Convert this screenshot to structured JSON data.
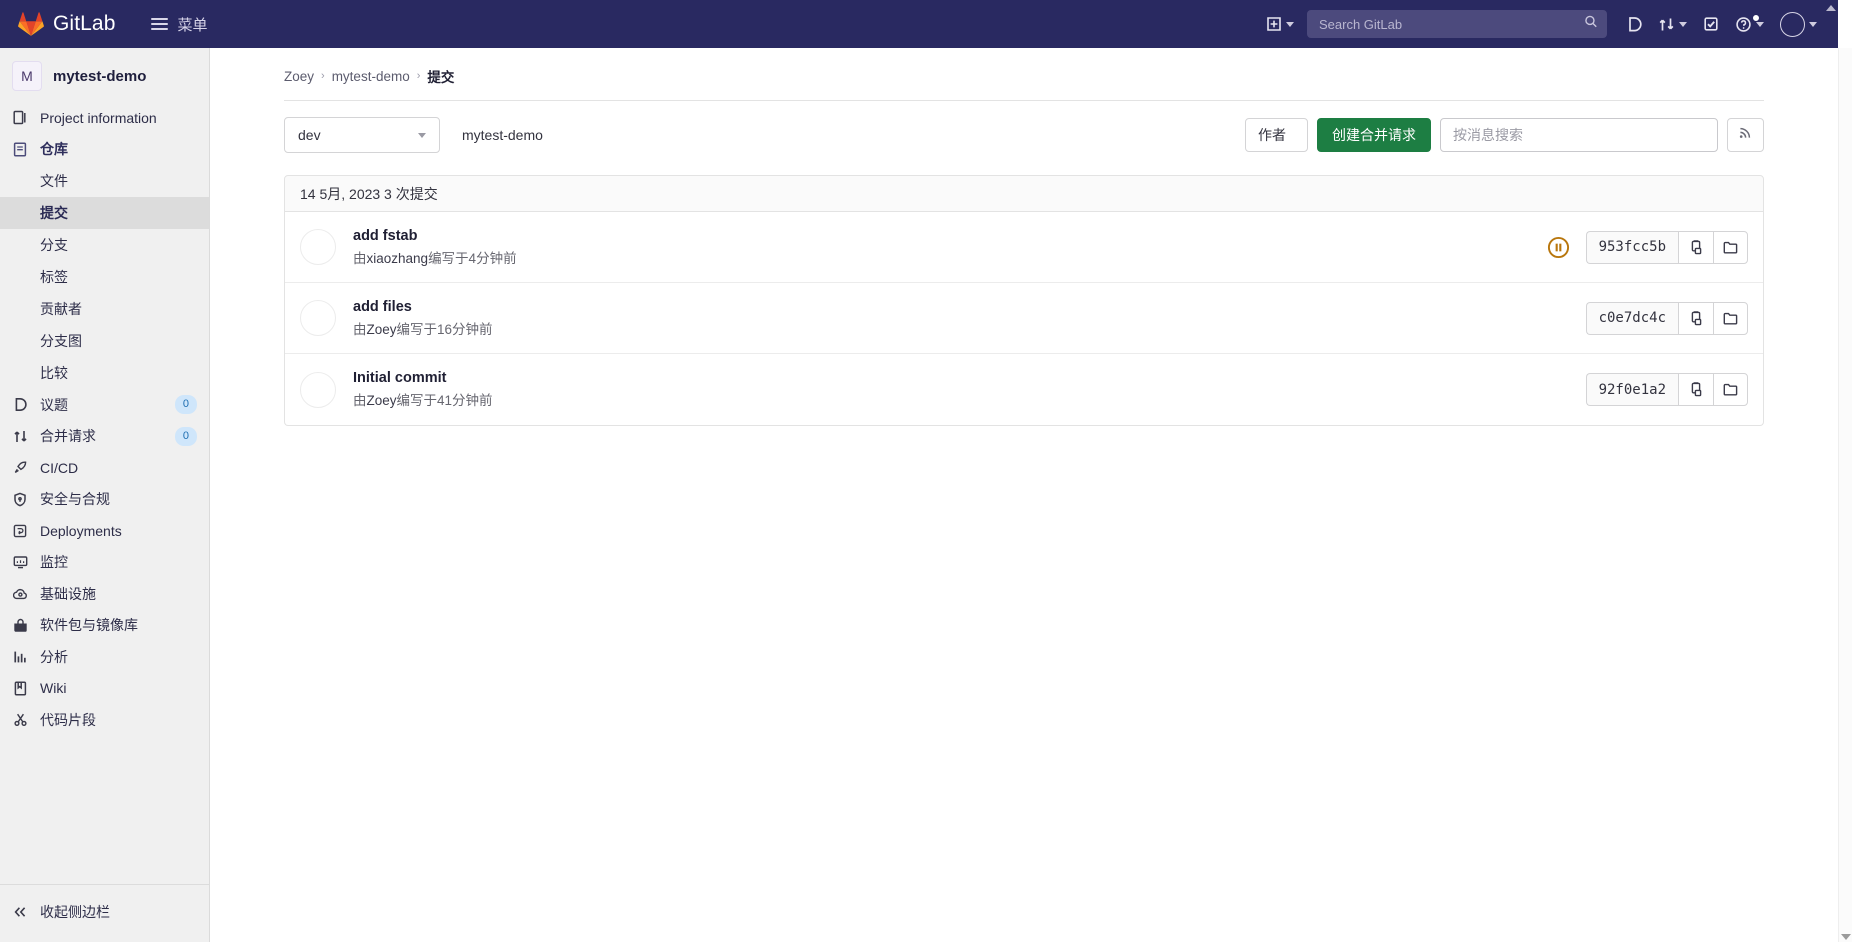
{
  "navbar": {
    "brand": "GitLab",
    "menu_label": "菜单",
    "search_placeholder": "Search GitLab",
    "icons": {
      "plus": "plus-square-icon",
      "issues": "issues-icon",
      "merge_requests": "merge-request-icon",
      "todos": "todo-check-icon",
      "help": "help-circle-icon",
      "avatar": "user-avatar"
    },
    "accent_bg": "#292961"
  },
  "sidebar": {
    "project": {
      "initial": "M",
      "name": "mytest-demo"
    },
    "items": [
      {
        "label": "Project information",
        "icon": "project-info-icon",
        "badge": ""
      },
      {
        "label": "仓库",
        "icon": "repository-icon",
        "badge": "",
        "active_parent": true
      },
      {
        "label": "议题",
        "icon": "issues-icon",
        "badge": "0"
      },
      {
        "label": "合并请求",
        "icon": "merge-request-icon",
        "badge": "0"
      },
      {
        "label": "CI/CD",
        "icon": "rocket-icon",
        "badge": ""
      },
      {
        "label": "安全与合规",
        "icon": "shield-icon",
        "badge": ""
      },
      {
        "label": "Deployments",
        "icon": "deployments-icon",
        "badge": ""
      },
      {
        "label": "监控",
        "icon": "monitor-icon",
        "badge": ""
      },
      {
        "label": "基础设施",
        "icon": "infrastructure-icon",
        "badge": ""
      },
      {
        "label": "软件包与镜像库",
        "icon": "package-icon",
        "badge": ""
      },
      {
        "label": "分析",
        "icon": "analytics-icon",
        "badge": ""
      },
      {
        "label": "Wiki",
        "icon": "wiki-book-icon",
        "badge": ""
      },
      {
        "label": "代码片段",
        "icon": "snippet-scissors-icon",
        "badge": ""
      }
    ],
    "repo_subitems": [
      {
        "label": "文件",
        "current": false
      },
      {
        "label": "提交",
        "current": true
      },
      {
        "label": "分支",
        "current": false
      },
      {
        "label": "标签",
        "current": false
      },
      {
        "label": "贡献者",
        "current": false
      },
      {
        "label": "分支图",
        "current": false
      },
      {
        "label": "比较",
        "current": false
      }
    ],
    "collapse_label": "收起侧边栏",
    "collapse_icon": "chevron-double-left-icon",
    "badge_color": "#cfe6fb"
  },
  "breadcrumb": {
    "items": [
      "Zoey",
      "mytest-demo"
    ],
    "current": "提交",
    "separator": "›"
  },
  "toolbar": {
    "branch_value": "dev",
    "repo_label": "mytest-demo",
    "author_label": "作者",
    "create_mr_label": "创建合并请求",
    "message_search_placeholder": "按消息搜索",
    "rss_icon": "rss-feed-icon",
    "mr_button_color": "#1d7e43"
  },
  "commits": {
    "day_header": "14 5月, 2023 3 次提交",
    "rows": [
      {
        "title": "add fstab",
        "meta_prefix": "由",
        "author": "xiaozhang",
        "meta_suffix": "编写于4分钟前",
        "sha": "953fcc5b",
        "pipeline_status": "pending",
        "pipeline_color": "#b8760c",
        "copy_icon": "copy-clipboard-icon",
        "browse_icon": "browse-files-folder-icon"
      },
      {
        "title": "add files",
        "meta_prefix": "由",
        "author": "Zoey",
        "meta_suffix": "编写于16分钟前",
        "sha": "c0e7dc4c",
        "pipeline_status": "none",
        "pipeline_color": "",
        "copy_icon": "copy-clipboard-icon",
        "browse_icon": "browse-files-folder-icon"
      },
      {
        "title": "Initial commit",
        "meta_prefix": "由",
        "author": "Zoey",
        "meta_suffix": "编写于41分钟前",
        "sha": "92f0e1a2",
        "pipeline_status": "none",
        "pipeline_color": "",
        "copy_icon": "copy-clipboard-icon",
        "browse_icon": "browse-files-folder-icon"
      }
    ]
  }
}
